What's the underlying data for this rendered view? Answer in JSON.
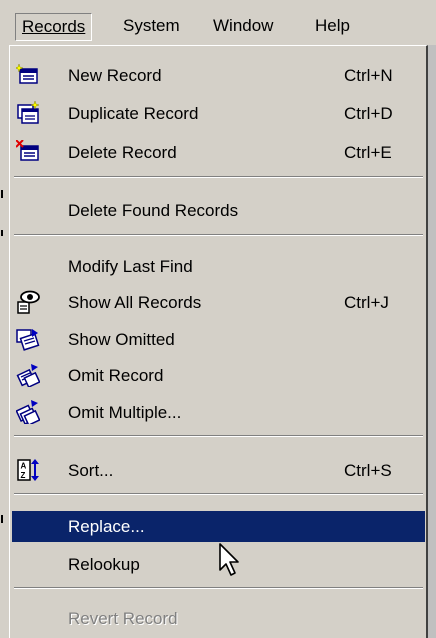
{
  "menubar": {
    "records": "Records",
    "system": "System",
    "window": "Window",
    "help": "Help"
  },
  "menu": {
    "new_record": {
      "label": "New Record",
      "shortcut": "Ctrl+N",
      "icon": "new-record-icon"
    },
    "duplicate_record": {
      "label": "Duplicate Record",
      "shortcut": "Ctrl+D",
      "icon": "duplicate-record-icon"
    },
    "delete_record": {
      "label": "Delete Record",
      "shortcut": "Ctrl+E",
      "icon": "delete-record-icon"
    },
    "delete_found": {
      "label": "Delete Found Records"
    },
    "modify_last_find": {
      "label": "Modify Last Find"
    },
    "show_all": {
      "label": "Show All Records",
      "shortcut": "Ctrl+J",
      "icon": "show-all-records-icon"
    },
    "show_omitted": {
      "label": "Show Omitted",
      "icon": "show-omitted-icon"
    },
    "omit_record": {
      "label": "Omit Record",
      "icon": "omit-record-icon"
    },
    "omit_multiple": {
      "label": "Omit Multiple...",
      "icon": "omit-multiple-icon"
    },
    "sort": {
      "label": "Sort...",
      "shortcut": "Ctrl+S",
      "icon": "sort-icon"
    },
    "replace": {
      "label": "Replace...",
      "state": "highlighted"
    },
    "relookup": {
      "label": "Relookup"
    },
    "revert_record": {
      "label": "Revert Record",
      "state": "disabled"
    }
  },
  "colors": {
    "menu_bg": "#d4d0c8",
    "highlight": "#0a246a",
    "disabled_text": "#808080"
  }
}
